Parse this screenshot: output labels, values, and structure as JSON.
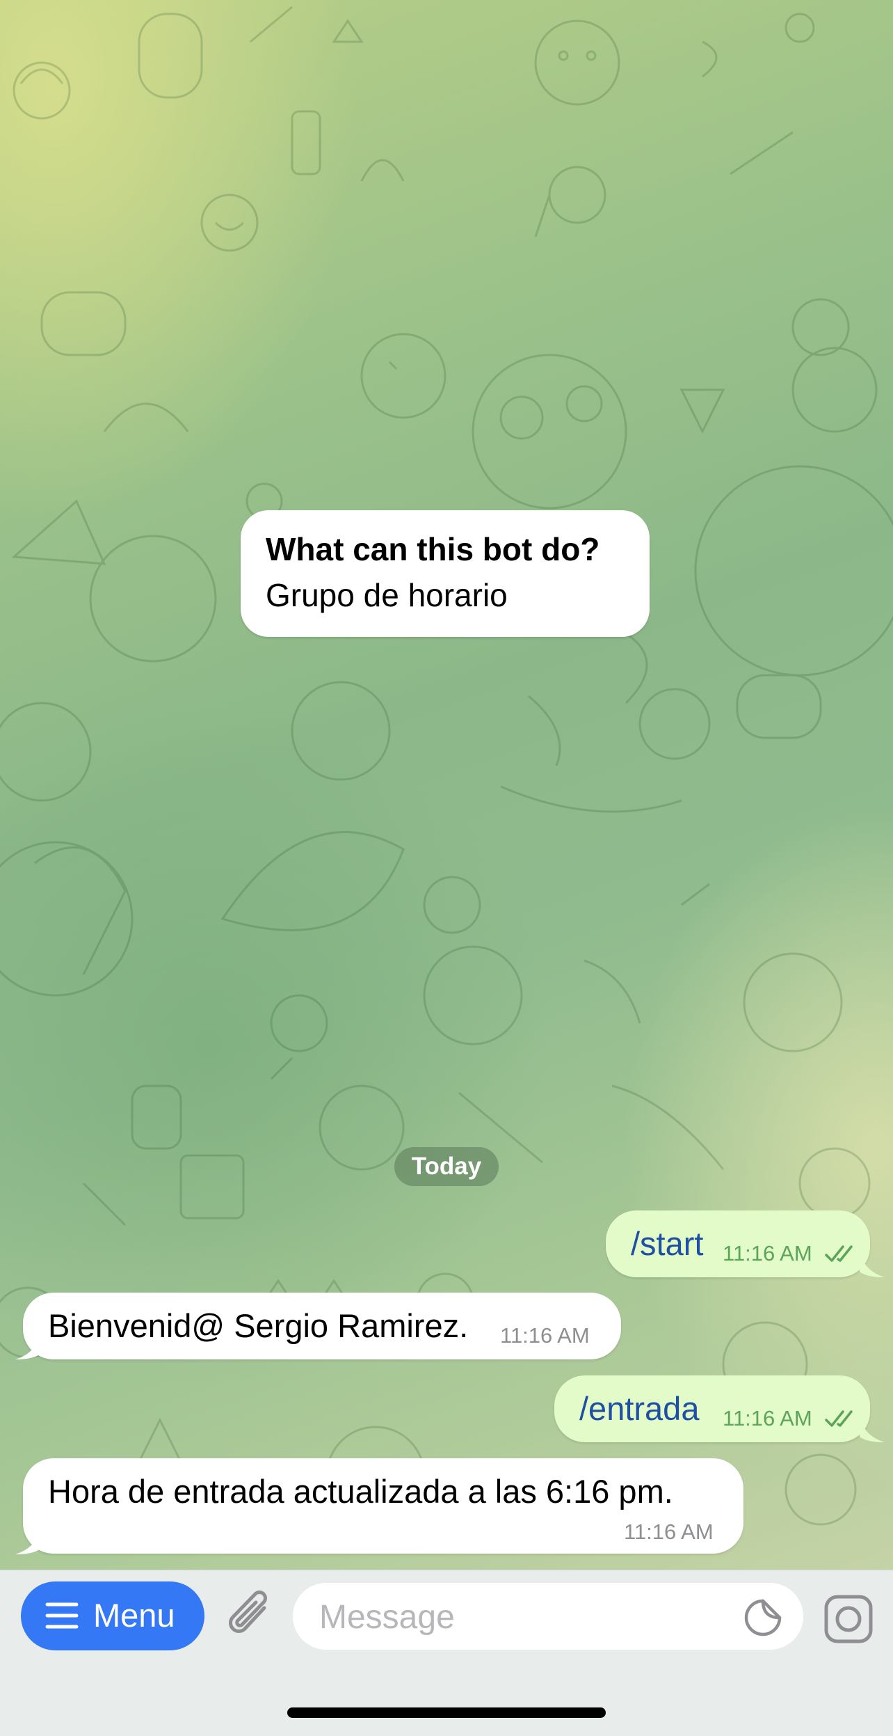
{
  "intro": {
    "title": "What can this bot do?",
    "text": "Grupo de horario"
  },
  "date_separator": "Today",
  "messages": [
    {
      "direction": "out",
      "text": "/start",
      "time": "11:16 AM",
      "status": "read"
    },
    {
      "direction": "in",
      "text": "Bienvenid@ Sergio Ramirez.",
      "time": "11:16 AM"
    },
    {
      "direction": "out",
      "text": "/entrada",
      "time": "11:16 AM",
      "status": "read"
    },
    {
      "direction": "in",
      "text": "Hora de entrada actualizada a las 6:16 pm.",
      "time": "11:16 AM"
    }
  ],
  "input_bar": {
    "menu_label": "Menu",
    "message_placeholder": "Message",
    "icons": [
      "menu-lines-icon",
      "paperclip-icon",
      "sticker-icon",
      "camera-icon"
    ]
  },
  "colors": {
    "outgoing_bubble": "#e3fbc8",
    "incoming_bubble": "#ffffff",
    "accent": "#3478f6",
    "command_link": "#1f4fa3",
    "outgoing_time": "#5ca45a"
  }
}
